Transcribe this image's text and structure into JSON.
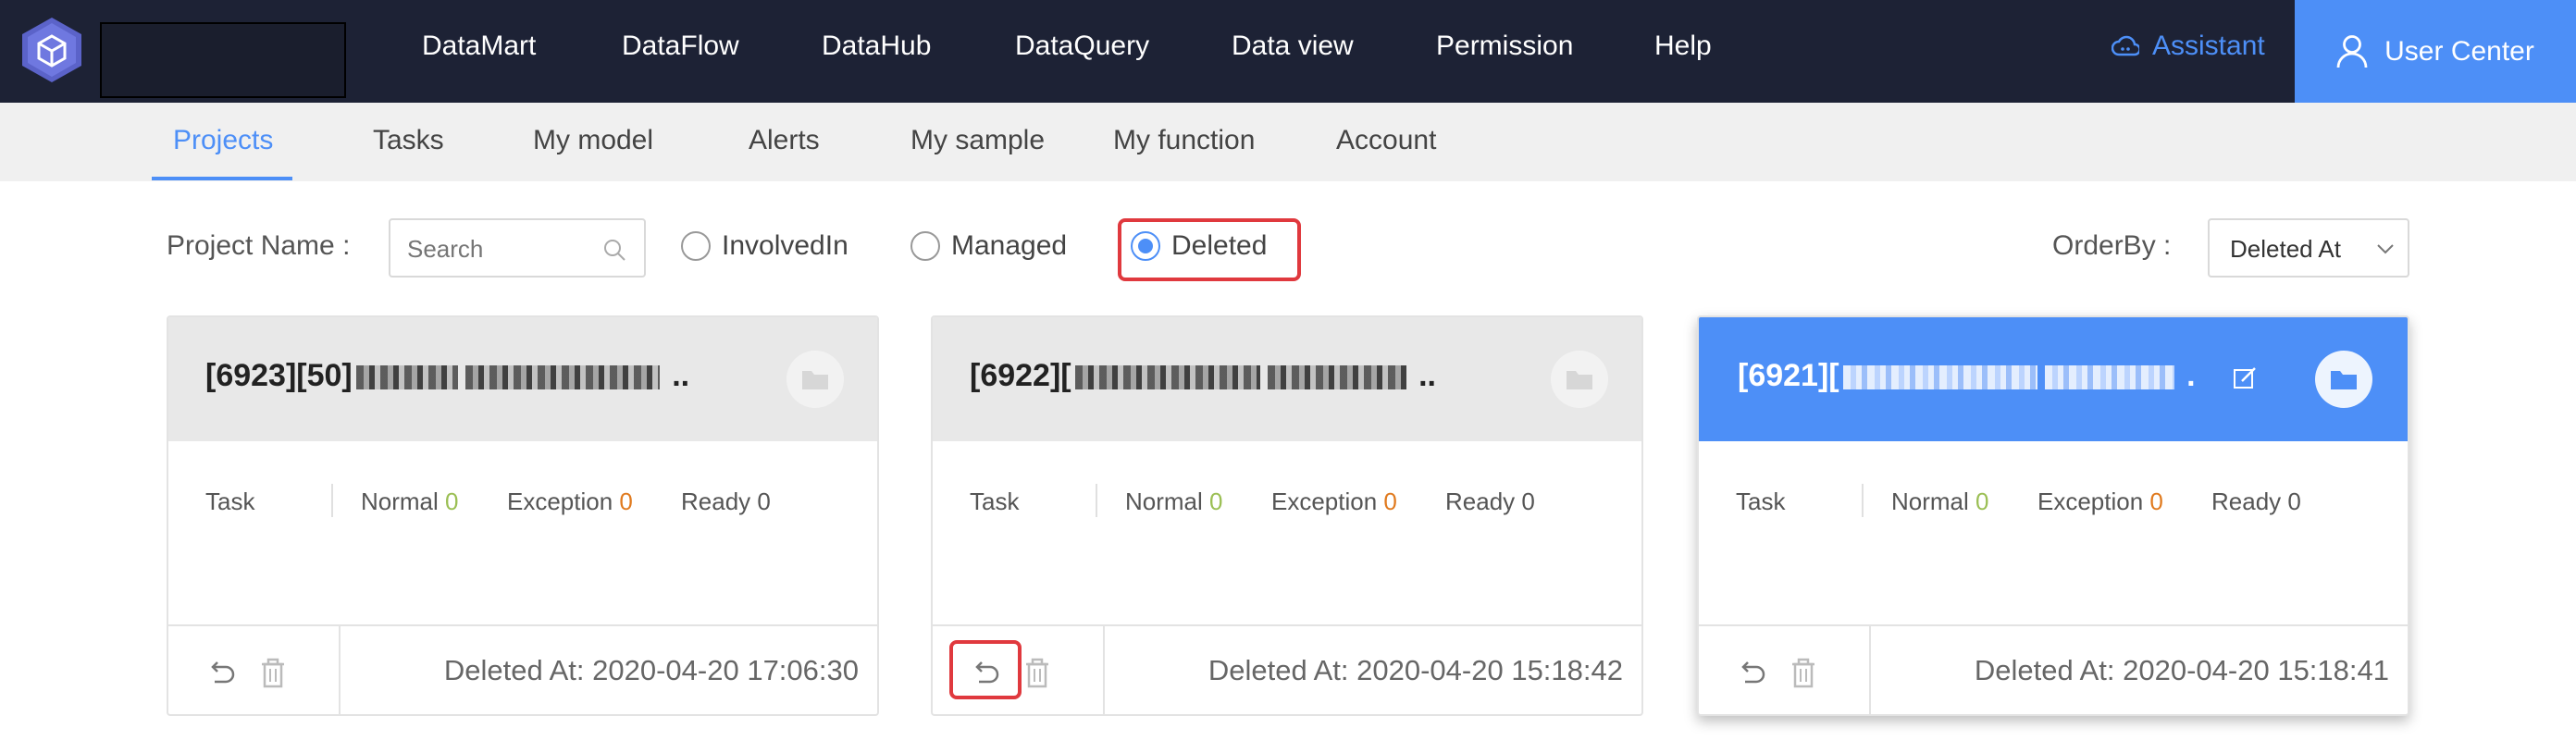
{
  "topbar": {
    "nav": [
      "DataMart",
      "DataFlow",
      "DataHub",
      "DataQuery",
      "Data view",
      "Permission",
      "Help"
    ],
    "assistant": "Assistant",
    "user_center": "User Center"
  },
  "subnav": {
    "tabs": [
      "Projects",
      "Tasks",
      "My model",
      "Alerts",
      "My sample",
      "My function",
      "Account"
    ],
    "active_tab": "Projects"
  },
  "filter": {
    "project_name_label": "Project Name :",
    "search_placeholder": "Search",
    "radios": [
      "InvolvedIn",
      "Managed",
      "Deleted"
    ],
    "selected_radio": "Deleted",
    "orderby_label": "OrderBy :",
    "orderby_value": "Deleted At"
  },
  "cards": [
    {
      "id_prefix": "[6923][50]",
      "suffix": "..",
      "task_label": "Task",
      "normal_label": "Normal",
      "normal": "0",
      "exception_label": "Exception",
      "exception": "0",
      "ready_label": "Ready",
      "ready": "0",
      "deleted_at": "Deleted At: 2020-04-20 17:06:30"
    },
    {
      "id_prefix": "[6922][",
      "suffix": "..",
      "task_label": "Task",
      "normal_label": "Normal",
      "normal": "0",
      "exception_label": "Exception",
      "exception": "0",
      "ready_label": "Ready",
      "ready": "0",
      "deleted_at": "Deleted At: 2020-04-20 15:18:42"
    },
    {
      "id_prefix": "[6921][",
      "suffix": ".",
      "task_label": "Task",
      "normal_label": "Normal",
      "normal": "0",
      "exception_label": "Exception",
      "exception": "0",
      "ready_label": "Ready",
      "ready": "0",
      "deleted_at": "Deleted At: 2020-04-20 15:18:41"
    }
  ],
  "colors": {
    "topbar_bg": "#1d2235",
    "accent": "#4d8ff7",
    "highlight_red": "#e0393e",
    "normal_green": "#9bbf54",
    "exception_orange": "#e07a1e"
  }
}
